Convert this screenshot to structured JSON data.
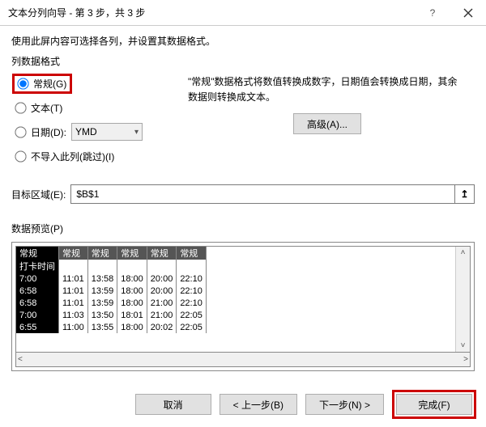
{
  "title": "文本分列向导 - 第 3 步，共 3 步",
  "instruction": "使用此屏内容可选择各列，并设置其数据格式。",
  "group_label": "列数据格式",
  "radios": {
    "general": "常规(G)",
    "text": "文本(T)",
    "date": "日期(D):",
    "skip": "不导入此列(跳过)(I)"
  },
  "date_format": "YMD",
  "description": "\"常规\"数据格式将数值转换成数字，日期值会转换成日期，其余数据则转换成文本。",
  "advanced_btn": "高级(A)...",
  "dest_label": "目标区域(E):",
  "dest_value": "$B$1",
  "preview_label": "数据预览(P)",
  "headers": [
    "常规",
    "常规",
    "常规",
    "常规",
    "常规",
    "常规"
  ],
  "rows": [
    [
      "打卡时间",
      "",
      "",
      "",
      "",
      ""
    ],
    [
      "7:00",
      "11:01",
      "13:58",
      "18:00",
      "20:00",
      "22:10"
    ],
    [
      "6:58",
      "11:01",
      "13:59",
      "18:00",
      "20:00",
      "22:10"
    ],
    [
      "6:58",
      "11:01",
      "13:59",
      "18:00",
      "21:00",
      "22:10"
    ],
    [
      "7:00",
      "11:03",
      "13:50",
      "18:01",
      "21:00",
      "22:05"
    ],
    [
      "6:55",
      "11:00",
      "13:55",
      "18:00",
      "20:02",
      "22:05"
    ]
  ],
  "buttons": {
    "cancel": "取消",
    "back": "< 上一步(B)",
    "next": "下一步(N) >",
    "finish": "完成(F)"
  }
}
